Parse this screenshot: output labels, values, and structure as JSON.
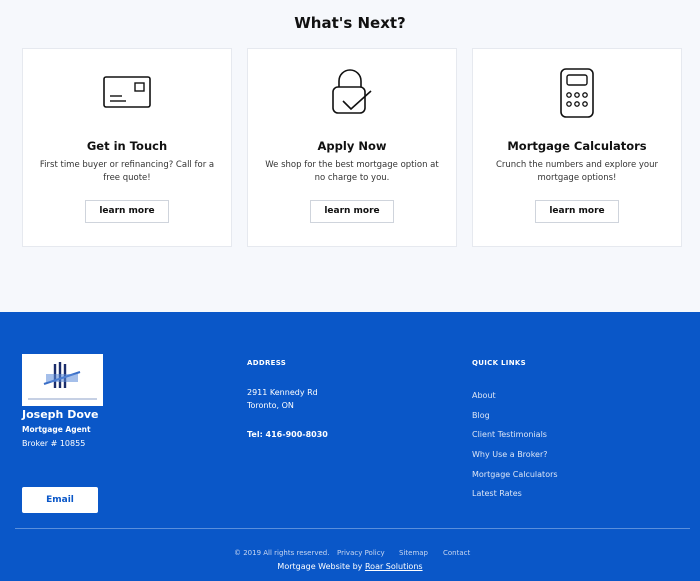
{
  "heading": "What's Next?",
  "cards": [
    {
      "icon": "business-card-icon",
      "title": "Get in Touch",
      "desc": "First time buyer or refinancing? Call for a free quote!",
      "button": "learn more"
    },
    {
      "icon": "lock-check-icon",
      "title": "Apply Now",
      "desc": "We shop for the best mortgage option at no charge to you.",
      "button": "learn more"
    },
    {
      "icon": "calculator-icon",
      "title": "Mortgage Calculators",
      "desc": "Crunch the numbers and explore your mortgage options!",
      "button": "learn more"
    }
  ],
  "footer": {
    "logo_text": "NATIONAL MORTGAGE LOANS",
    "name": "Joseph Dove",
    "role": "Mortgage Agent",
    "broker": "Broker # 10855",
    "email_button": "Email",
    "address_heading": "ADDRESS",
    "address_line1": "2911 Kennedy Rd",
    "address_line2": "Toronto, ON",
    "tel": "Tel: 416-900-8030",
    "quick_links_heading": "QUICK LINKS",
    "quick_links": [
      "About",
      "Blog",
      "Client Testimonials",
      "Why Use a Broker?",
      "Mortgage Calculators",
      "Latest Rates"
    ],
    "copyright": "© 2019 All rights reserved.",
    "privacy": "Privacy Policy",
    "sitemap": "Sitemap",
    "contact": "Contact",
    "credit_prefix": "Mortgage Website by",
    "credit_link": "Roar Solutions"
  },
  "colors": {
    "footer_bg": "#0a57c8",
    "page_bg": "#f6f8fc"
  }
}
